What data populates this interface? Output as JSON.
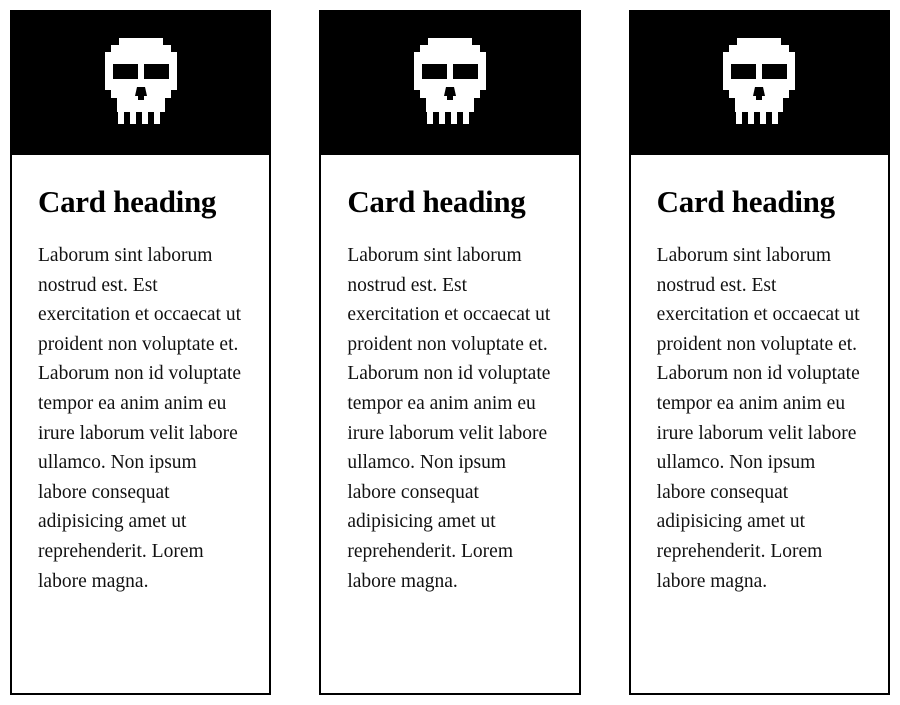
{
  "page": {
    "background_color": "#ffffff",
    "accent_color": "#000000",
    "card_count": 3
  },
  "cards": [
    {
      "icon": "skull-icon",
      "header_color": "#000000",
      "heading": "Card heading",
      "body": "Laborum sint laborum nostrud est. Est exercitation et occaecat ut proident non voluptate et. Laborum non id voluptate tempor ea anim anim eu irure laborum velit labore ullamco. Non ipsum labore consequat adipisicing amet ut reprehenderit. Lorem labore magna."
    },
    {
      "icon": "skull-icon",
      "header_color": "#000000",
      "heading": "Card heading",
      "body": "Laborum sint laborum nostrud est. Est exercitation et occaecat ut proident non voluptate et. Laborum non id voluptate tempor ea anim anim eu irure laborum velit labore ullamco. Non ipsum labore consequat adipisicing amet ut reprehenderit. Lorem labore magna."
    },
    {
      "icon": "skull-icon",
      "header_color": "#000000",
      "heading": "Card heading",
      "body": "Laborum sint laborum nostrud est. Est exercitation et occaecat ut proident non voluptate et. Laborum non id voluptate tempor ea anim anim eu irure laborum velit labore ullamco. Non ipsum labore consequat adipisicing amet ut reprehenderit. Lorem labore magna."
    }
  ]
}
